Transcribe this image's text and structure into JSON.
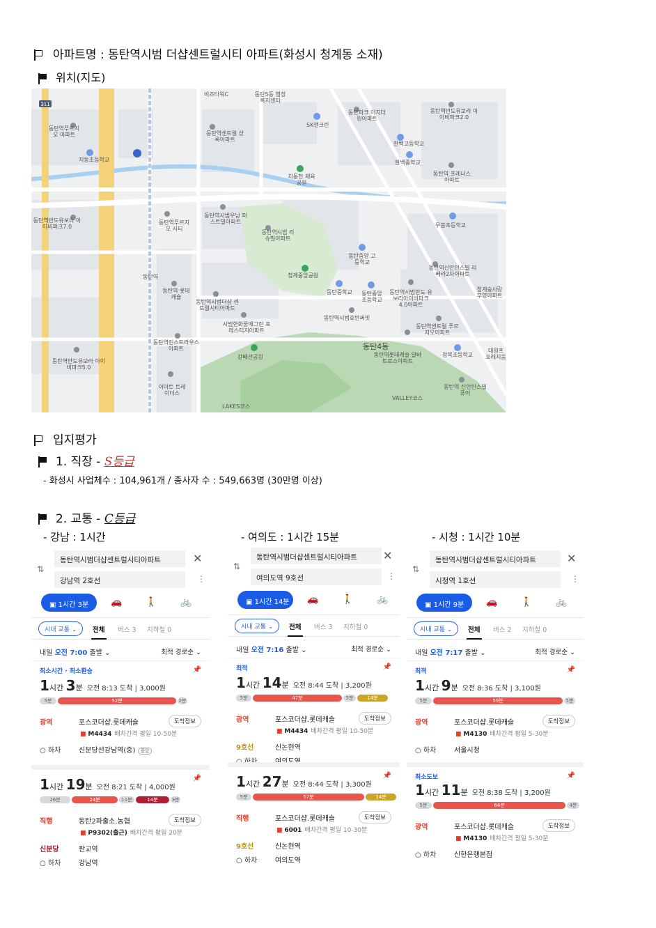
{
  "title_line": "아파트명 : 동탄역시범 더샵센트럴시티 아파트(화성시 청계동 소재)",
  "location_label": "위치(지도)",
  "map": {
    "labels": [
      "비즈타워C",
      "동탄5동 행정복지센터",
      "동탄파크 이지더원아파트",
      "동탄역반도유보라 아이비파크2.0",
      "동탄역푸르지오 아파트",
      "SK엔크린",
      "동탄역센트럴 상록아파트",
      "한백고등학교",
      "한백중학교",
      "치동초등학교",
      "치동천 체육공원",
      "동탄역 포레너스아파트",
      "동탄역시범우남 퍼스트빌아파트",
      "동탄역반도유보라 아이비파크7.0",
      "동탄역푸르지오 시티",
      "동탄역시범 리슈빌아파트",
      "무봉초등학교",
      "동탄중앙 고등학교",
      "청계중앙공원",
      "동탄역신안인스빌 리베라2차아파트",
      "동탄역",
      "동탄역 롯데캐슬",
      "동탄역시범더샵 센트럴시티아파트",
      "동탄중학교",
      "동탄중앙 초등학교",
      "동탄역시범반도 유보라아이비파크 4.0아파트",
      "청계숲사랑 부영아파트",
      "동탄역시범호반써밋",
      "시범한화꿈에그린 프레스티지아파트",
      "동탄역센트럴 푸르지오아파트",
      "동탄역린스트라우스 아파트",
      "동탄4동",
      "동탄역롯데캐슬 알바트로스아파트",
      "청목초등학교",
      "대원프 포레지움",
      "강배산공원",
      "동탄역반도유보라 아이비파크5.0",
      "이마트 트레이더스",
      "동탄역 신안인스빌퓨어",
      "LAKES코스",
      "VALLEY코스",
      "311"
    ]
  },
  "evaluation_label": "입지평가",
  "job": {
    "heading": "1. 직장 -",
    "grade": "S등급",
    "detail": "- 화성시 사업체수 :  104,961개 / 종사자 수 : 549,663명 (30만명 이상)"
  },
  "transport": {
    "heading": "2. 교통 -",
    "grade": "C등급",
    "cols": [
      "- 강남 : 1시간",
      "- 여의도 : 1시간 15분",
      "- 시청 : 1시간 10분"
    ]
  },
  "cards": [
    {
      "from": "동탄역시범더샵센트럴시티아파트",
      "to": "강남역 2호선",
      "mode": "1시간 3분",
      "pill": "시내 교통 ⌄",
      "tab_all": "전체",
      "tab_bus": "버스 3",
      "tab_sub": "지하철 0",
      "depart_pre": "내일 ",
      "depart_time": "오전 7:00",
      "depart_post": " 출발 ⌄",
      "sort": "최적 경로순 ⌄",
      "r1": {
        "tag": "최소시간 · 최소환승",
        "h": "1",
        "hu": "시간 ",
        "m": "3",
        "mu": "분",
        "meta": "오전 8:13 도착 | 3,000원",
        "segs": [
          "5분",
          "52분",
          "2분"
        ],
        "s1": {
          "lbl": "광역",
          "stop": "포스코더샵.롯데캐슬",
          "info": "도착정보",
          "bus": "M4434",
          "freq": "배차간격 평일 10-50분"
        },
        "s2": {
          "lbl": "○ 하차",
          "stop": "신분당선강남역(중)",
          "extra": "중앙"
        }
      },
      "r2": {
        "h": "1",
        "hu": "시간 ",
        "m": "19",
        "mu": "분",
        "meta": "오전 8:21 도착 | 4,000원",
        "segs": [
          "26분",
          "24분",
          "11분",
          "14분",
          "3분"
        ],
        "s1": {
          "lbl": "직행",
          "stop": "동탄2파출소.농협",
          "info": "도착정보",
          "bus": "P9302(출근)",
          "freq": "배차간격 평일 20분"
        },
        "s2": {
          "lbl": "신분당",
          "stop": "판교역"
        },
        "s3": {
          "lbl": "○ 하차",
          "stop": "강남역"
        }
      }
    },
    {
      "from": "동탄역시범더샵센트럴시티아파트",
      "to": "여의도역 9호선",
      "mode": "1시간 14분",
      "pill": "시내 교통 ⌄",
      "tab_all": "전체",
      "tab_bus": "버스 3",
      "tab_sub": "지하철 0",
      "depart_pre": "내일 ",
      "depart_time": "오전 7:16",
      "depart_post": " 출발 ⌄",
      "sort": "최적 경로순 ⌄",
      "r1": {
        "tag": "최적",
        "h": "1",
        "hu": "시간 ",
        "m": "14",
        "mu": "분",
        "meta": "오전 8:44 도착 | 3,200원",
        "segs": [
          "5분",
          "47분",
          "5분",
          "14분"
        ],
        "s1": {
          "lbl": "광역",
          "stop": "포스코더샵.롯데캐슬",
          "info": "도착정보",
          "bus": "M4434",
          "freq": "배차간격 평일 10-50분"
        },
        "s2": {
          "lbl": "9호선",
          "stop": "신논현역"
        },
        "s3": {
          "lbl": "○ 하차",
          "stop": "여의도역"
        }
      },
      "r2": {
        "h": "1",
        "hu": "시간 ",
        "m": "27",
        "mu": "분",
        "meta": "오전 8:44 도착 | 3,300원",
        "segs": [
          "5분",
          "57분",
          "14분"
        ],
        "s1": {
          "lbl": "직행",
          "stop": "포스코더샵.롯데캐슬",
          "info": "도착정보",
          "bus": "6001",
          "freq": "배차간격 평일 10-30분"
        },
        "s2": {
          "lbl": "9호선",
          "stop": "신논현역"
        },
        "s3": {
          "lbl": "○ 하차",
          "stop": "여의도역"
        }
      }
    },
    {
      "from": "동탄역시범더샵센트럴시티아파트",
      "to": "시청역 1호선",
      "mode": "1시간 9분",
      "pill": "시내 교통 ⌄",
      "tab_all": "전체",
      "tab_bus": "버스 2",
      "tab_sub": "지하철 0",
      "depart_pre": "내일 ",
      "depart_time": "오전 7:17",
      "depart_post": " 출발 ⌄",
      "sort": "최적 경로순 ⌄",
      "r1": {
        "tag": "최적",
        "h": "1",
        "hu": "시간 ",
        "m": "9",
        "mu": "분",
        "meta": "오전 8:36 도착 | 3,100원",
        "segs": [
          "5분",
          "59분",
          "5분"
        ],
        "s1": {
          "lbl": "광역",
          "stop": "포스코더샵.롯데캐슬",
          "info": "도착정보",
          "bus": "M4130",
          "freq": "배차간격 평일 5-30분"
        },
        "s2": {
          "lbl": "○ 하차",
          "stop": "서울시청"
        }
      },
      "r2": {
        "tag": "최소도보",
        "h": "1",
        "hu": "시간 ",
        "m": "11",
        "mu": "분",
        "meta": "오전 8:38 도착 | 3,200원",
        "segs": [
          "5분",
          "64분",
          "4분"
        ],
        "s1": {
          "lbl": "광역",
          "stop": "포스코더샵.롯데캐슬",
          "info": "도착정보",
          "bus": "M4130",
          "freq": "배차간격 평일 5-30분"
        },
        "s2": {
          "lbl": "○ 하차",
          "stop": "신한은행본점"
        }
      }
    }
  ]
}
